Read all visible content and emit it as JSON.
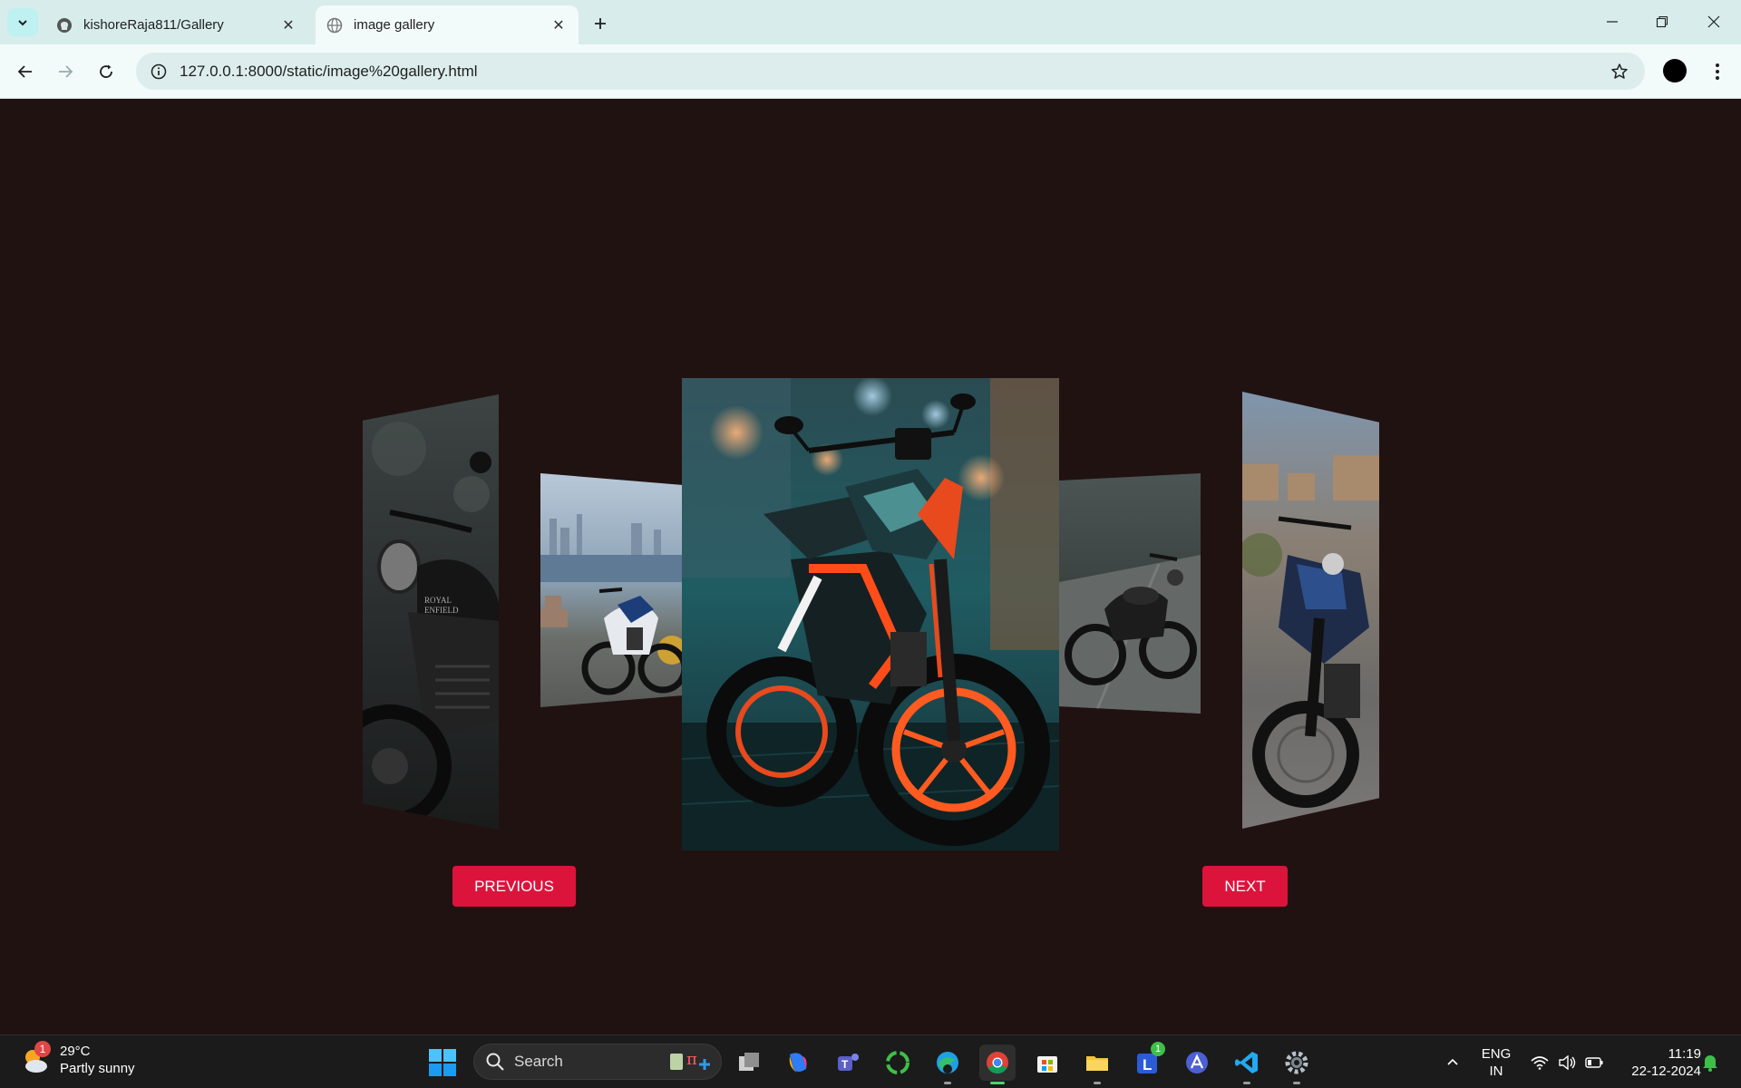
{
  "browser": {
    "tabs": [
      {
        "title": "kishoreRaja811/Gallery",
        "favicon": "github-icon",
        "active": false
      },
      {
        "title": "image gallery",
        "favicon": "globe-icon",
        "active": true
      }
    ],
    "url": "127.0.0.1:8000/static/image%20gallery.html"
  },
  "gallery": {
    "slides": [
      {
        "position": "left-far",
        "subject": "black Royal Enfield motorcycle"
      },
      {
        "position": "left-near",
        "subject": "blue and white sport motorcycle by a city view"
      },
      {
        "position": "center",
        "subject": "orange and teal KTM Duke motorcycle"
      },
      {
        "position": "right-near",
        "subject": "dark motorcycle on a road"
      },
      {
        "position": "right-far",
        "subject": "blue cruiser motorcycle in a street"
      }
    ],
    "prev_label": "PREVIOUS",
    "next_label": "NEXT",
    "accent_color": "#dc143c",
    "background_color": "#211212"
  },
  "taskbar": {
    "weather": {
      "temp": "29°C",
      "condition": "Partly sunny",
      "badge": "1"
    },
    "search_label": "Search",
    "apps": [
      "file-explorer-icon",
      "copilot-icon",
      "teams-icon",
      "refresh-app-icon",
      "edge-icon",
      "chrome-icon",
      "store-icon",
      "folder-icon",
      "l-app-icon",
      "arc-icon",
      "vscode-icon",
      "settings-icon"
    ],
    "l_app_badge": "1",
    "language": {
      "line1": "ENG",
      "line2": "IN"
    },
    "clock": {
      "time": "11:19",
      "date": "22-12-2024"
    }
  }
}
